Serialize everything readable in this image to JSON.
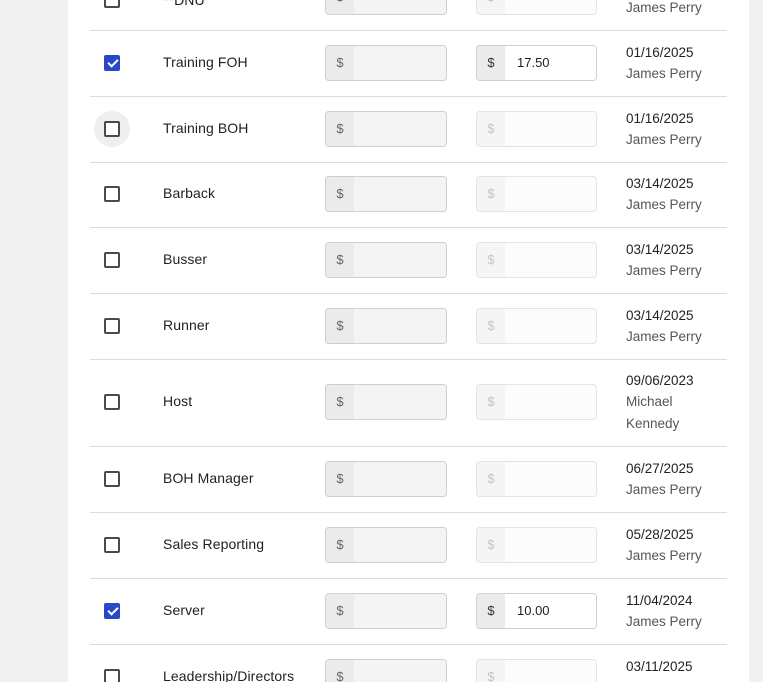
{
  "currency_symbol": "$",
  "rows": [
    {
      "name": "**DNU",
      "checked": false,
      "rate1": "",
      "rate2": "",
      "rate2_enabled": false,
      "date": "",
      "by": "James Perry"
    },
    {
      "name": "Training FOH",
      "checked": true,
      "rate1": "",
      "rate2": "17.50",
      "rate2_enabled": true,
      "date": "01/16/2025",
      "by": "James Perry"
    },
    {
      "name": "Training BOH",
      "checked": false,
      "hover": true,
      "rate1": "",
      "rate2": "",
      "rate2_enabled": false,
      "date": "01/16/2025",
      "by": "James Perry"
    },
    {
      "name": "Barback",
      "checked": false,
      "rate1": "",
      "rate2": "",
      "rate2_enabled": false,
      "date": "03/14/2025",
      "by": "James Perry"
    },
    {
      "name": "Busser",
      "checked": false,
      "rate1": "",
      "rate2": "",
      "rate2_enabled": false,
      "date": "03/14/2025",
      "by": "James Perry"
    },
    {
      "name": "Runner",
      "checked": false,
      "rate1": "",
      "rate2": "",
      "rate2_enabled": false,
      "date": "03/14/2025",
      "by": "James Perry"
    },
    {
      "name": "Host",
      "checked": false,
      "rate1": "",
      "rate2": "",
      "rate2_enabled": false,
      "date": "09/06/2023",
      "by": "Michael",
      "by2": "Kennedy"
    },
    {
      "name": "BOH Manager",
      "checked": false,
      "rate1": "",
      "rate2": "",
      "rate2_enabled": false,
      "date": "06/27/2025",
      "by": "James Perry"
    },
    {
      "name": "Sales Reporting",
      "checked": false,
      "rate1": "",
      "rate2": "",
      "rate2_enabled": false,
      "date": "05/28/2025",
      "by": "James Perry"
    },
    {
      "name": "Server",
      "checked": true,
      "rate1": "",
      "rate2": "10.00",
      "rate2_enabled": true,
      "date": "11/04/2024",
      "by": "James Perry"
    },
    {
      "name": "Leadership/Directors",
      "checked": false,
      "rate1": "",
      "rate2": "",
      "rate2_enabled": false,
      "date": "03/11/2025",
      "by": ""
    }
  ]
}
